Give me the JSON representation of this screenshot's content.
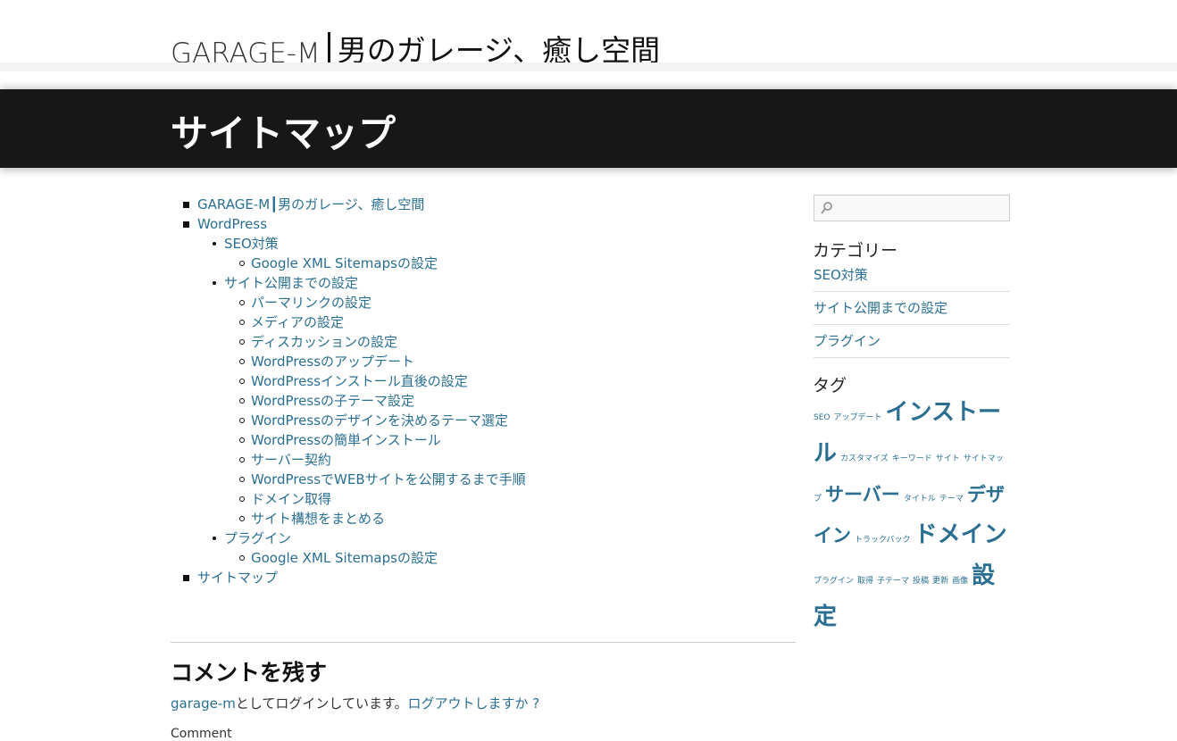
{
  "header": {
    "brand": "GARAGE-M",
    "tagline": "男のガレージ、癒し空間"
  },
  "page": {
    "title": "サイトマップ"
  },
  "sitemap": [
    {
      "label": "GARAGE-M┃男のガレージ、癒し空間"
    },
    {
      "label": "WordPress",
      "children": [
        {
          "label": "SEO対策",
          "children": [
            "Google XML Sitemapsの設定"
          ]
        },
        {
          "label": "サイト公開までの設定",
          "children": [
            "パーマリンクの設定",
            "メディアの設定",
            "ディスカッションの設定",
            "WordPressのアップデート",
            "WordPressインストール直後の設定",
            "WordPressの子テーマ設定",
            "WordPressのデザインを決めるテーマ選定",
            "WordPressの簡単インストール",
            "サーバー契約",
            "WordPressでWEBサイトを公開するまで手順",
            "ドメイン取得",
            "サイト構想をまとめる"
          ]
        },
        {
          "label": "プラグイン",
          "children": [
            "Google XML Sitemapsの設定"
          ]
        }
      ]
    },
    {
      "label": "サイトマップ"
    }
  ],
  "comments": {
    "heading": "コメントを残す",
    "logged_in_user": "garage-m",
    "logged_in_text": "としてログインしています。",
    "logout_link": "ログアウトしますか ?",
    "comment_label": "Comment"
  },
  "sidebar": {
    "search": {
      "placeholder": "",
      "icon": "search-icon"
    },
    "categories_title": "カテゴリー",
    "categories": [
      "SEO対策",
      "サイト公開までの設定",
      "プラグイン"
    ],
    "tags_title": "タグ",
    "tags": [
      {
        "label": "SEO",
        "size": "sm"
      },
      {
        "label": "アップデート",
        "size": "sm"
      },
      {
        "label": "インストール",
        "size": "lg"
      },
      {
        "label": "カスタマイズ",
        "size": "sm"
      },
      {
        "label": "キーワード",
        "size": "sm"
      },
      {
        "label": "サイト",
        "size": "sm"
      },
      {
        "label": "サイトマップ",
        "size": "sm"
      },
      {
        "label": "サーバー",
        "size": "md"
      },
      {
        "label": "タイトル",
        "size": "sm"
      },
      {
        "label": "テーマ",
        "size": "sm"
      },
      {
        "label": "デザイン",
        "size": "md"
      },
      {
        "label": "トラックバック",
        "size": "sm"
      },
      {
        "label": "ドメイン",
        "size": "lg"
      },
      {
        "label": "プラグイン",
        "size": "sm"
      },
      {
        "label": "取得",
        "size": "sm"
      },
      {
        "label": "子テーマ",
        "size": "sm"
      },
      {
        "label": "投稿",
        "size": "sm"
      },
      {
        "label": "更新",
        "size": "sm"
      },
      {
        "label": "画像",
        "size": "sm"
      },
      {
        "label": "設定",
        "size": "lg"
      }
    ]
  }
}
